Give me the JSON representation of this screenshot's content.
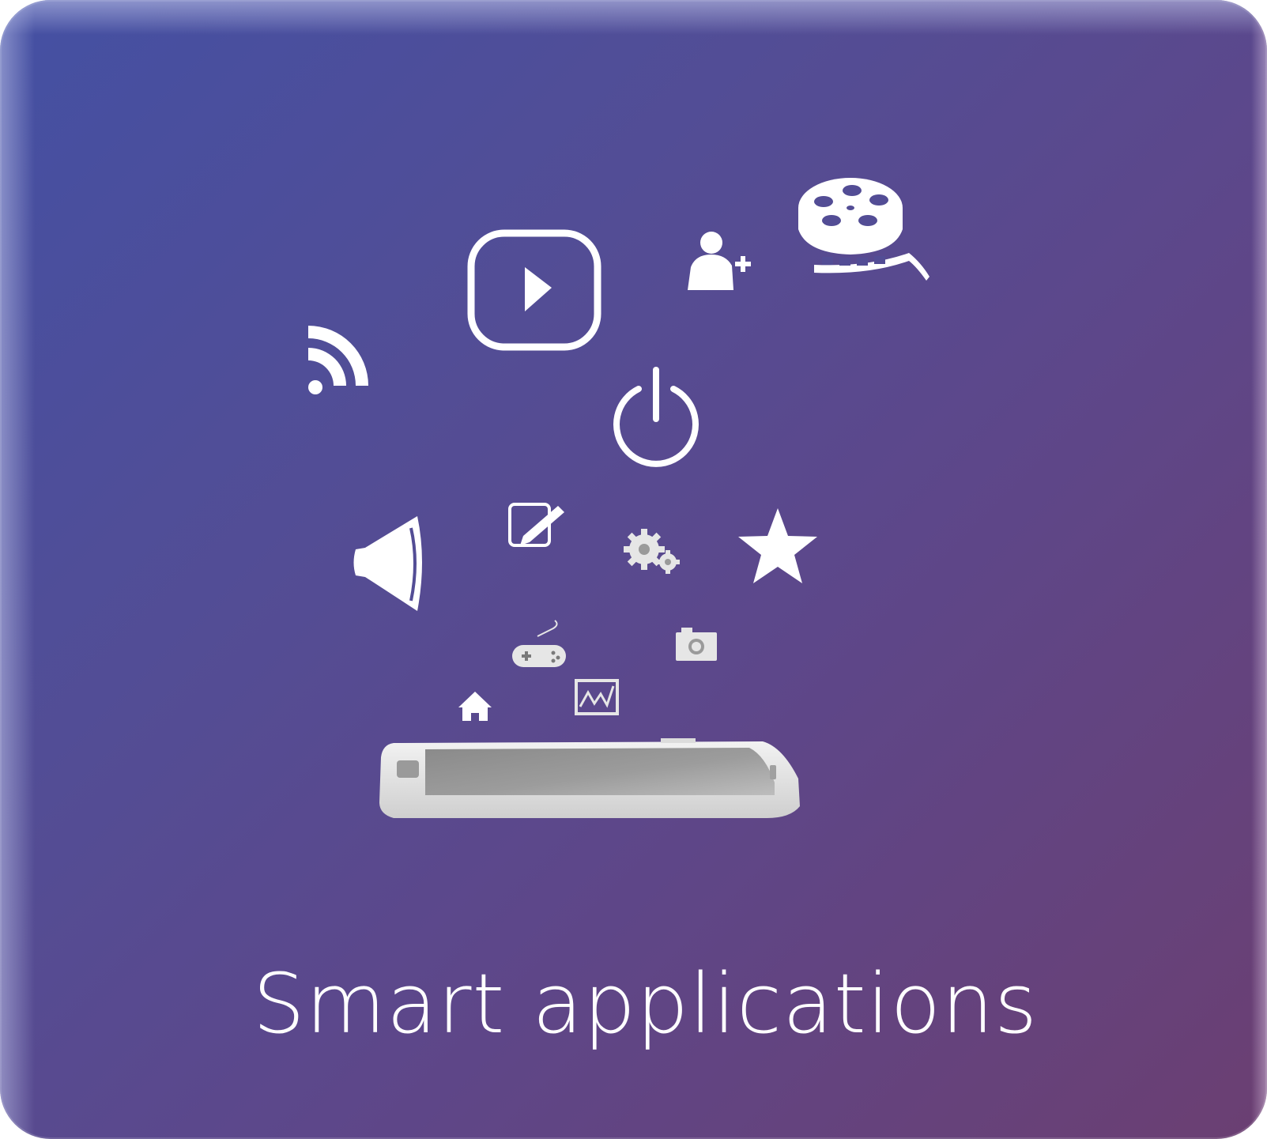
{
  "tile": {
    "title": "Smart applications",
    "gradient": [
      "#4450a3",
      "#534d95",
      "#5d478a",
      "#6b3f72"
    ],
    "icon_color": "#ffffff"
  },
  "icons": [
    "rss-icon",
    "play-button-icon",
    "add-user-icon",
    "film-reel-icon",
    "power-icon",
    "edit-note-icon",
    "speaker-icon",
    "gears-icon",
    "star-icon",
    "gamepad-icon",
    "camera-icon",
    "home-icon",
    "chart-image-icon",
    "smartphone-icon"
  ]
}
